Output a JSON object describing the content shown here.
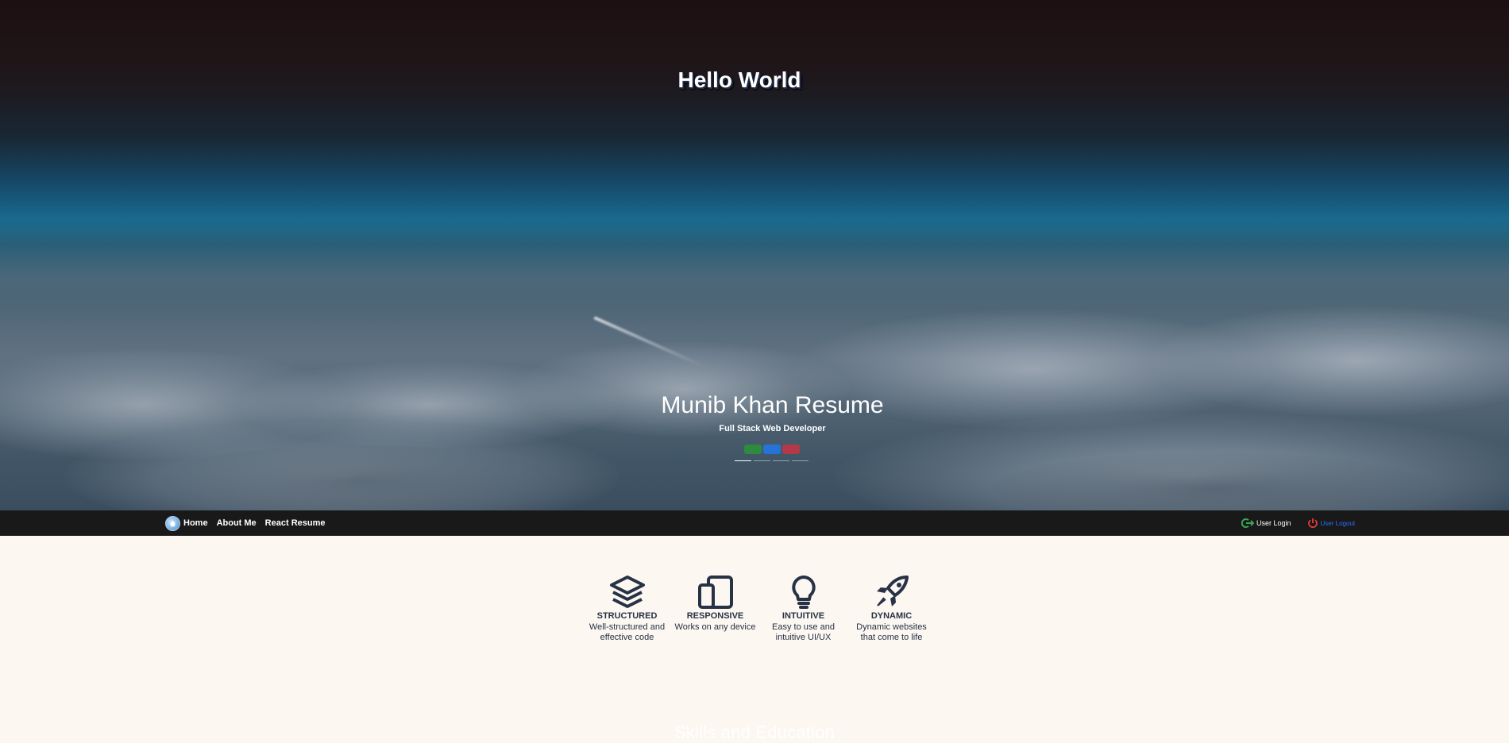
{
  "hero": {
    "greeting": "Hello World",
    "title": "Munib Khan Resume",
    "subtitle": "Full Stack Web Developer",
    "pill_colors": [
      "#2e8a3e",
      "#2673d8",
      "#b23a48"
    ],
    "indicator_count": 4,
    "active_indicator": 0
  },
  "nav": {
    "home": "Home",
    "about": "About Me",
    "react": "React Resume",
    "login": "User Login",
    "logout": "User Logout",
    "colors": {
      "login_icon": "#3aa655",
      "logout_icon": "#e23b3b",
      "logout_text": "#2a6cff"
    }
  },
  "features": [
    {
      "icon": "layers-icon",
      "title": "STRUCTURED",
      "desc1": "Well-structured and",
      "desc2": "effective code"
    },
    {
      "icon": "devices-icon",
      "title": "RESPONSIVE",
      "desc1": "Works on any device",
      "desc2": ""
    },
    {
      "icon": "lightbulb-icon",
      "title": "INTUITIVE",
      "desc1": "Easy to use and",
      "desc2": "intuitive UI/UX"
    },
    {
      "icon": "rocket-icon",
      "title": "DYNAMIC",
      "desc1": "Dynamic websites",
      "desc2": "that come to life"
    }
  ],
  "skills_heading": "Skills and Education"
}
